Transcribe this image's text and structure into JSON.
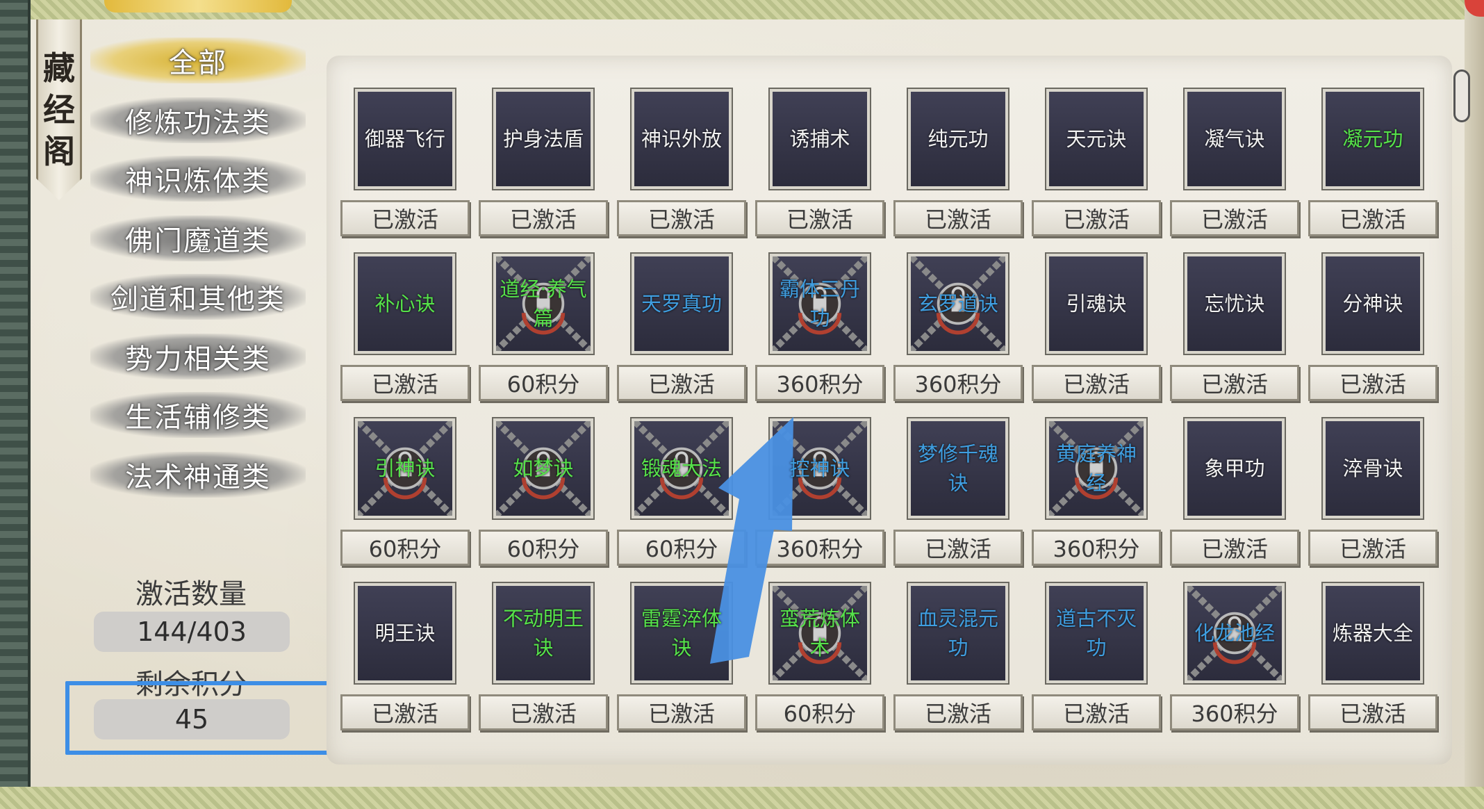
{
  "sidebar": {
    "title_chars": [
      "藏",
      "经",
      "阁"
    ],
    "categories": [
      {
        "label": "全部",
        "active": true
      },
      {
        "label": "修炼功法类",
        "active": false
      },
      {
        "label": "神识炼体类",
        "active": false
      },
      {
        "label": "佛门魔道类",
        "active": false
      },
      {
        "label": "剑道和其他类",
        "active": false
      },
      {
        "label": "势力相关类",
        "active": false
      },
      {
        "label": "生活辅修类",
        "active": false
      },
      {
        "label": "法术神通类",
        "active": false
      }
    ],
    "activation_label": "激活数量",
    "activation_value": "144/403",
    "points_label": "剩余积分",
    "points_value": "45"
  },
  "skills": [
    {
      "name": "御器飞行",
      "color": "white",
      "locked": false,
      "status": "已激活"
    },
    {
      "name": "护身法盾",
      "color": "white",
      "locked": false,
      "status": "已激活"
    },
    {
      "name": "神识外放",
      "color": "white",
      "locked": false,
      "status": "已激活"
    },
    {
      "name": "诱捕术",
      "color": "white",
      "locked": false,
      "status": "已激活"
    },
    {
      "name": "纯元功",
      "color": "white",
      "locked": false,
      "status": "已激活"
    },
    {
      "name": "天元诀",
      "color": "white",
      "locked": false,
      "status": "已激活"
    },
    {
      "name": "凝气诀",
      "color": "white",
      "locked": false,
      "status": "已激活"
    },
    {
      "name": "凝元功",
      "color": "green",
      "locked": false,
      "status": "已激活"
    },
    {
      "name": "补心诀",
      "color": "green",
      "locked": false,
      "status": "已激活"
    },
    {
      "name": "道经·养气篇",
      "color": "green",
      "locked": true,
      "status": "60积分"
    },
    {
      "name": "天罗真功",
      "color": "blue",
      "locked": false,
      "status": "已激活"
    },
    {
      "name": "霸体三丹功",
      "color": "blue",
      "locked": true,
      "status": "360积分"
    },
    {
      "name": "玄罗道诀",
      "color": "blue",
      "locked": true,
      "status": "360积分"
    },
    {
      "name": "引魂诀",
      "color": "white",
      "locked": false,
      "status": "已激活"
    },
    {
      "name": "忘忧诀",
      "color": "white",
      "locked": false,
      "status": "已激活"
    },
    {
      "name": "分神诀",
      "color": "white",
      "locked": false,
      "status": "已激活"
    },
    {
      "name": "引神诀",
      "color": "green",
      "locked": true,
      "status": "60积分"
    },
    {
      "name": "如梦诀",
      "color": "green",
      "locked": true,
      "status": "60积分"
    },
    {
      "name": "锻魂大法",
      "color": "green",
      "locked": true,
      "status": "60积分"
    },
    {
      "name": "控神诀",
      "color": "blue",
      "locked": true,
      "status": "360积分"
    },
    {
      "name": "梦修千魂诀",
      "color": "blue",
      "locked": false,
      "status": "已激活"
    },
    {
      "name": "黄庭养神经",
      "color": "blue",
      "locked": true,
      "status": "360积分"
    },
    {
      "name": "象甲功",
      "color": "white",
      "locked": false,
      "status": "已激活"
    },
    {
      "name": "淬骨诀",
      "color": "white",
      "locked": false,
      "status": "已激活"
    },
    {
      "name": "明王诀",
      "color": "white",
      "locked": false,
      "status": "已激活"
    },
    {
      "name": "不动明王诀",
      "color": "green",
      "locked": false,
      "status": "已激活"
    },
    {
      "name": "雷霆淬体诀",
      "color": "green",
      "locked": false,
      "status": "已激活"
    },
    {
      "name": "蛮荒炼体术",
      "color": "green",
      "locked": true,
      "status": "60积分"
    },
    {
      "name": "血灵混元功",
      "color": "blue",
      "locked": false,
      "status": "已激活"
    },
    {
      "name": "道古不灭功",
      "color": "blue",
      "locked": false,
      "status": "已激活"
    },
    {
      "name": "化龙池经",
      "color": "blue",
      "locked": true,
      "status": "360积分"
    },
    {
      "name": "炼器大全",
      "color": "white",
      "locked": false,
      "status": "已激活"
    }
  ],
  "colors": {
    "highlight": "#3d8ee6",
    "arrow": "#4a90e2",
    "name_green": "#56e24a",
    "name_blue": "#3f9ee0",
    "active_category": "#d7b232"
  }
}
